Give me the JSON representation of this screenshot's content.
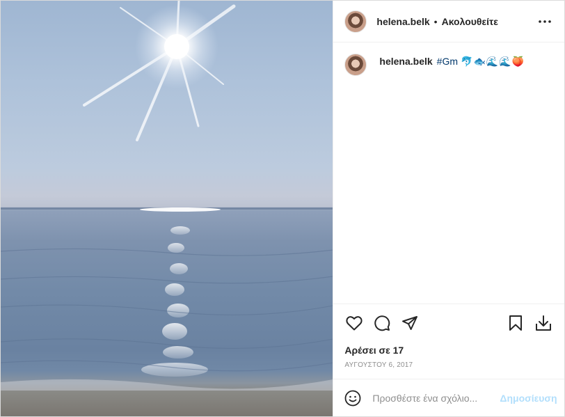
{
  "post": {
    "username": "helena.belk",
    "separator": "•",
    "follow_status": "Ακολουθείτε",
    "caption": {
      "username": "helena.belk",
      "hashtag": "#Gm",
      "emojis": "🐬🐟🌊🌊🍑"
    },
    "likes": "Αρέσει σε 17",
    "date": "ΑΥΓΟΥΣΤΟΥ 6, 2017"
  },
  "comment": {
    "placeholder": "Προσθέστε ένα σχόλιο...",
    "post_label": "Δημοσίευση"
  },
  "icons": {
    "more": "more-options-icon",
    "like": "heart-icon",
    "comment": "comment-icon",
    "share": "paper-plane-icon",
    "save": "bookmark-icon",
    "download": "download-icon",
    "emoji": "smiley-icon"
  },
  "colors": {
    "hashtag": "#00376b",
    "post_button": "#b2dffc",
    "muted": "#8e8e8e"
  }
}
